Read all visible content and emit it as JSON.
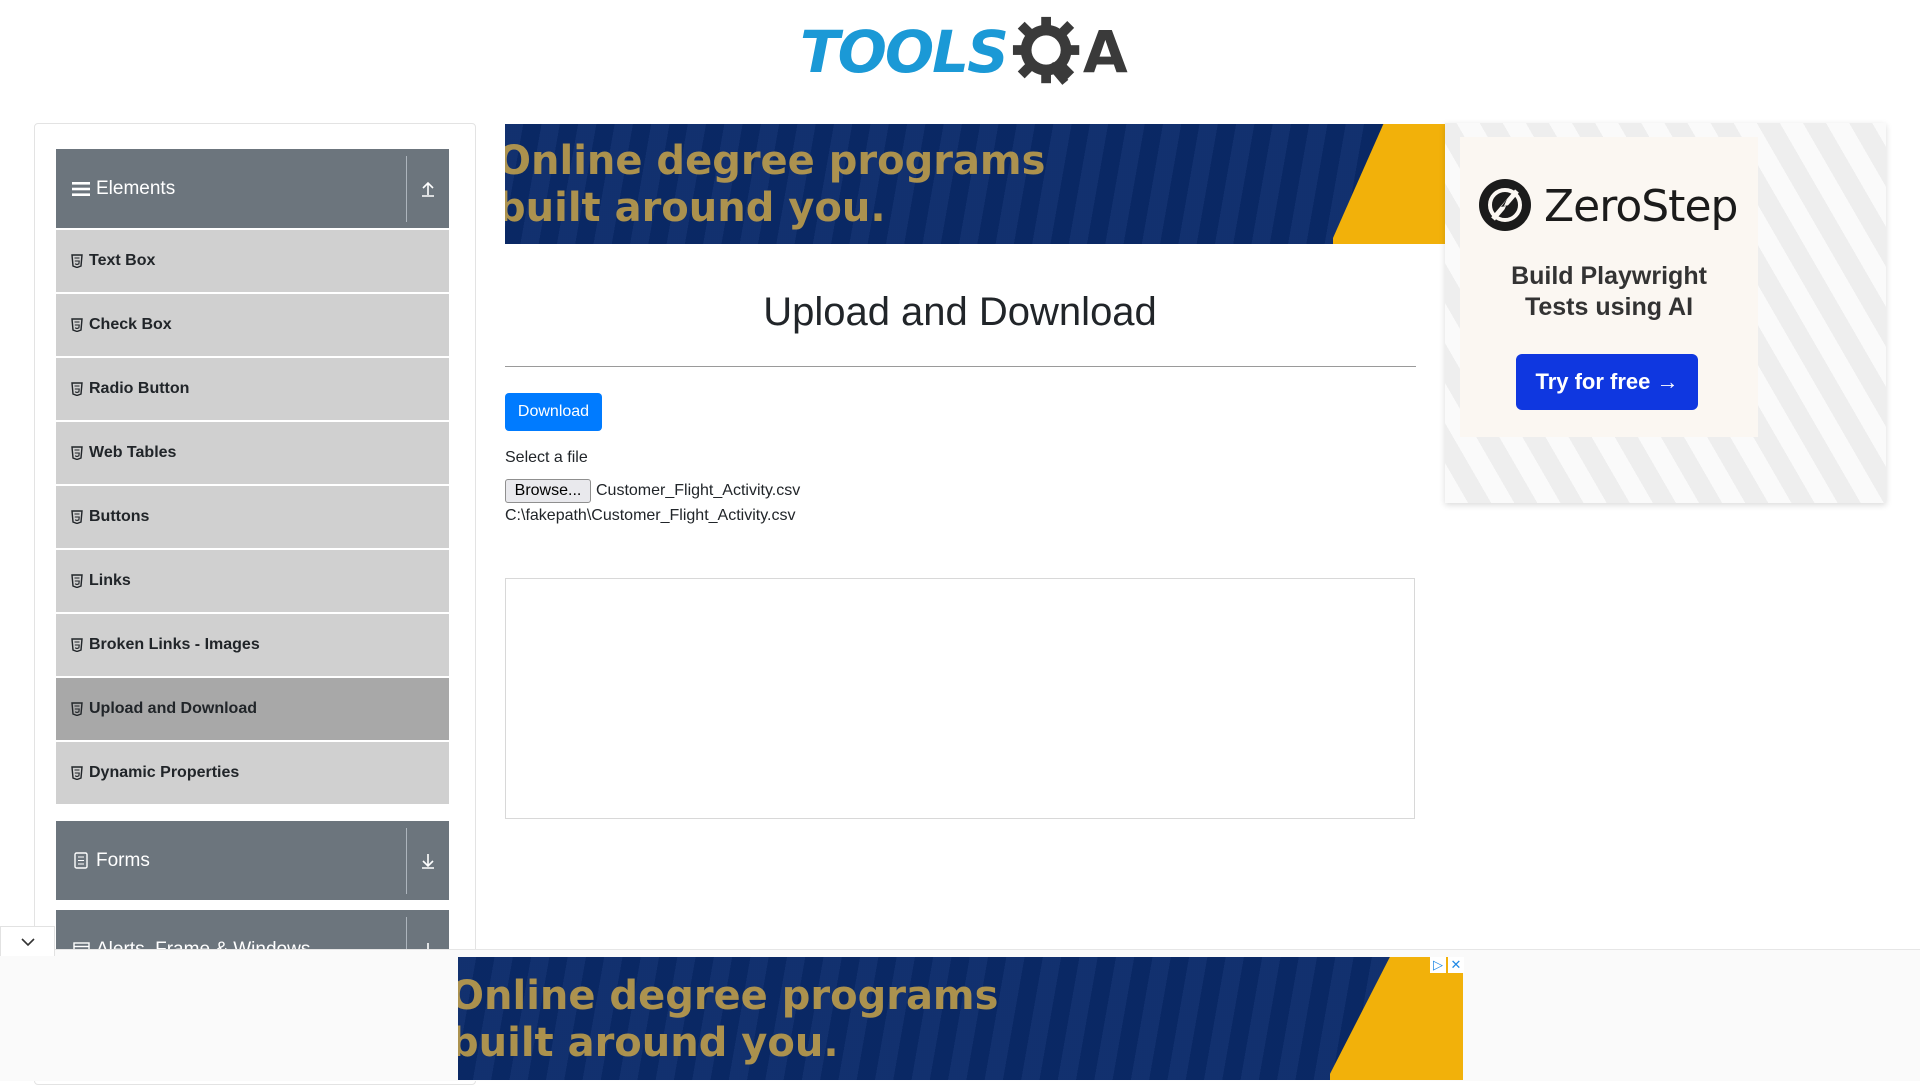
{
  "header": {
    "logo_tools": "TOOLS",
    "logo_a": "A"
  },
  "sidebar": {
    "groups": [
      {
        "label": "Elements",
        "icon": "hamburger-icon",
        "toggle": "collapse-up-icon",
        "expanded": true
      },
      {
        "label": "Forms",
        "icon": "document-icon",
        "toggle": "expand-down-icon",
        "expanded": false
      },
      {
        "label": "Alerts, Frame & Windows",
        "icon": "window-icon",
        "toggle": "expand-down-icon",
        "expanded": false
      }
    ],
    "items": [
      {
        "label": "Text Box"
      },
      {
        "label": "Check Box"
      },
      {
        "label": "Radio Button"
      },
      {
        "label": "Web Tables"
      },
      {
        "label": "Buttons"
      },
      {
        "label": "Links"
      },
      {
        "label": "Broken Links - Images"
      },
      {
        "label": "Upload and Download",
        "active": true
      },
      {
        "label": "Dynamic Properties"
      }
    ]
  },
  "banner": {
    "text": "Online degree programs\nbuilt around you."
  },
  "main": {
    "title": "Upload and Download",
    "download_label": "Download",
    "select_label": "Select a file",
    "browse_label": "Browse...",
    "file_name": "Customer_Flight_Activity.csv",
    "file_path": "C:\\fakepath\\Customer_Flight_Activity.csv"
  },
  "ad_right": {
    "brand": "ZeroStep",
    "tagline": "Build Playwright\nTests using AI",
    "cta": "Try for free →"
  },
  "ad_bottom": {
    "text": "Online degree programs\nbuilt around you."
  },
  "colors": {
    "brand_blue": "#1b99d6",
    "sidebar_group": "#6c757d",
    "sidebar_item": "#d0d0d0",
    "sidebar_active": "#a8a8a8",
    "primary_button": "#007bff",
    "cta_blue": "#0f37e0",
    "banner_navy": "#0a2a6a",
    "banner_yellow": "#f2b10a"
  }
}
